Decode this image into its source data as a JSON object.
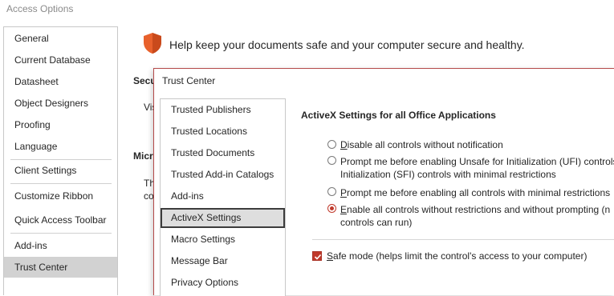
{
  "window": {
    "title": "Access Options"
  },
  "sidebar": {
    "items": [
      {
        "label": "General"
      },
      {
        "label": "Current Database"
      },
      {
        "label": "Datasheet"
      },
      {
        "label": "Object Designers"
      },
      {
        "label": "Proofing"
      },
      {
        "label": "Language"
      },
      {
        "label": "Client Settings"
      },
      {
        "label": "Customize Ribbon"
      },
      {
        "label": "Quick Access Toolbar"
      },
      {
        "label": "Add-ins"
      },
      {
        "label": "Trust Center"
      }
    ],
    "selected": "Trust Center"
  },
  "header": {
    "text": "Help keep your documents safe and your computer secure and healthy."
  },
  "background_fragments": {
    "secu": "Secu",
    "vis": "Vis",
    "micr": "Micr",
    "th": "Th",
    "co": "co"
  },
  "trust_center": {
    "title": "Trust Center",
    "nav": [
      {
        "label": "Trusted Publishers"
      },
      {
        "label": "Trusted Locations"
      },
      {
        "label": "Trusted Documents"
      },
      {
        "label": "Trusted Add-in Catalogs"
      },
      {
        "label": "Add-ins"
      },
      {
        "label": "ActiveX Settings"
      },
      {
        "label": "Macro Settings"
      },
      {
        "label": "Message Bar"
      },
      {
        "label": "Privacy Options"
      }
    ],
    "selected": "ActiveX Settings",
    "heading": "ActiveX Settings for all Office Applications",
    "options": [
      {
        "key": "D",
        "rest": "isable all controls without notification",
        "line2": "",
        "checked": false
      },
      {
        "key": "",
        "rest": "Prompt me before enabling Unsafe for Initialization (UFI) controls",
        "line2": "Initialization (SFI) controls with minimal restrictions",
        "checked": false
      },
      {
        "key": "P",
        "rest": "rompt me before enabling all controls with minimal restrictions",
        "line2": "",
        "checked": false
      },
      {
        "key": "E",
        "rest": "nable all controls without restrictions and without prompting (n",
        "line2": "controls can run)",
        "checked": true
      }
    ],
    "safe_mode": {
      "key": "S",
      "rest": "afe mode (helps limit the control's access to your computer)",
      "checked": true
    },
    "colors": {
      "accent": "#c0392b",
      "border": "#b44a4a"
    }
  }
}
